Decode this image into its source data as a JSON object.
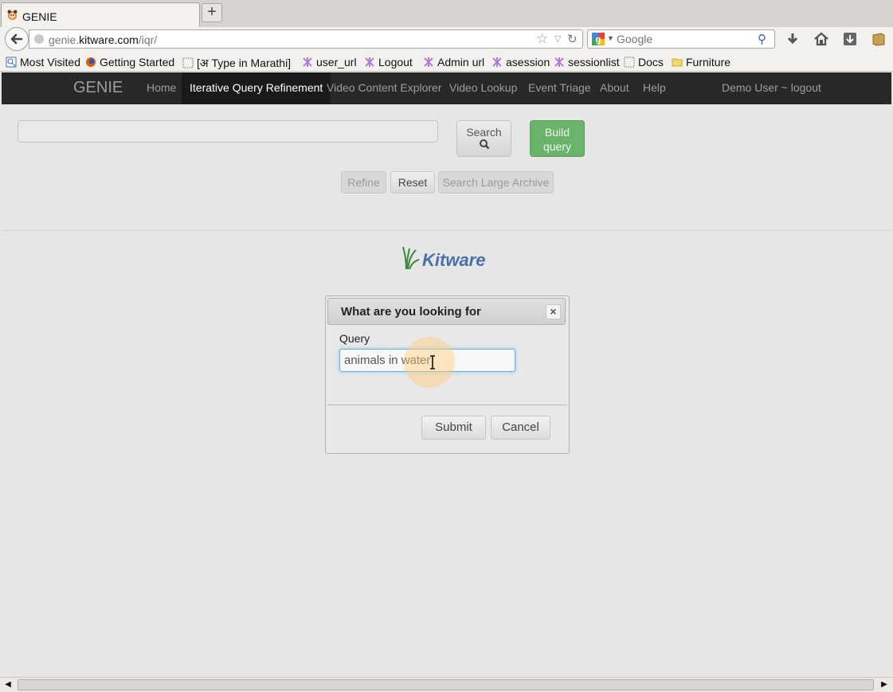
{
  "browser": {
    "tab_title": "GENIE",
    "new_tab_symbol": "+",
    "url_host_prefix": "genie.",
    "url_host_main": "kitware.com",
    "url_path": "/iqr/",
    "search_placeholder": "Google",
    "bookmarks": [
      {
        "label": "Most Visited",
        "icon": "most-visited-icon"
      },
      {
        "label": "Getting Started",
        "icon": "firefox-icon"
      },
      {
        "label": "[अ Type in Marathi]",
        "icon": "page-icon"
      },
      {
        "label": "user_url",
        "icon": "bookmark-icon"
      },
      {
        "label": "Logout",
        "icon": "bookmark-icon"
      },
      {
        "label": "Admin url",
        "icon": "bookmark-icon"
      },
      {
        "label": "asession",
        "icon": "bookmark-icon"
      },
      {
        "label": "sessionlist",
        "icon": "bookmark-icon"
      },
      {
        "label": "Docs",
        "icon": "page-icon"
      },
      {
        "label": "Furniture",
        "icon": "folder-icon"
      }
    ]
  },
  "app": {
    "brand": "GENIE",
    "nav": [
      {
        "label": "Home",
        "active": false
      },
      {
        "label": "Iterative Query Refinement",
        "active": true
      },
      {
        "label": "Video Content Explorer",
        "active": false
      },
      {
        "label": "Video Lookup",
        "active": false
      },
      {
        "label": "Event Triage",
        "active": false
      },
      {
        "label": "About",
        "active": false
      },
      {
        "label": "Help",
        "active": false
      }
    ],
    "user": "Demo User ~ logout"
  },
  "toolbar": {
    "search_label": "Search",
    "build_line1": "Build",
    "build_line2": "query",
    "refine_label": "Refine",
    "reset_label": "Reset",
    "archive_label": "Search Large Archive"
  },
  "logo_text": "Kitware",
  "modal": {
    "title": "What are you looking for",
    "close_symbol": "×",
    "query_label": "Query",
    "query_value": "animals in water",
    "submit_label": "Submit",
    "cancel_label": "Cancel"
  },
  "colors": {
    "navbar_bg": "#282828",
    "build_button": "#6ab36a",
    "focus_ring": "#66afe9",
    "logo_blue": "#4b6fa8"
  }
}
